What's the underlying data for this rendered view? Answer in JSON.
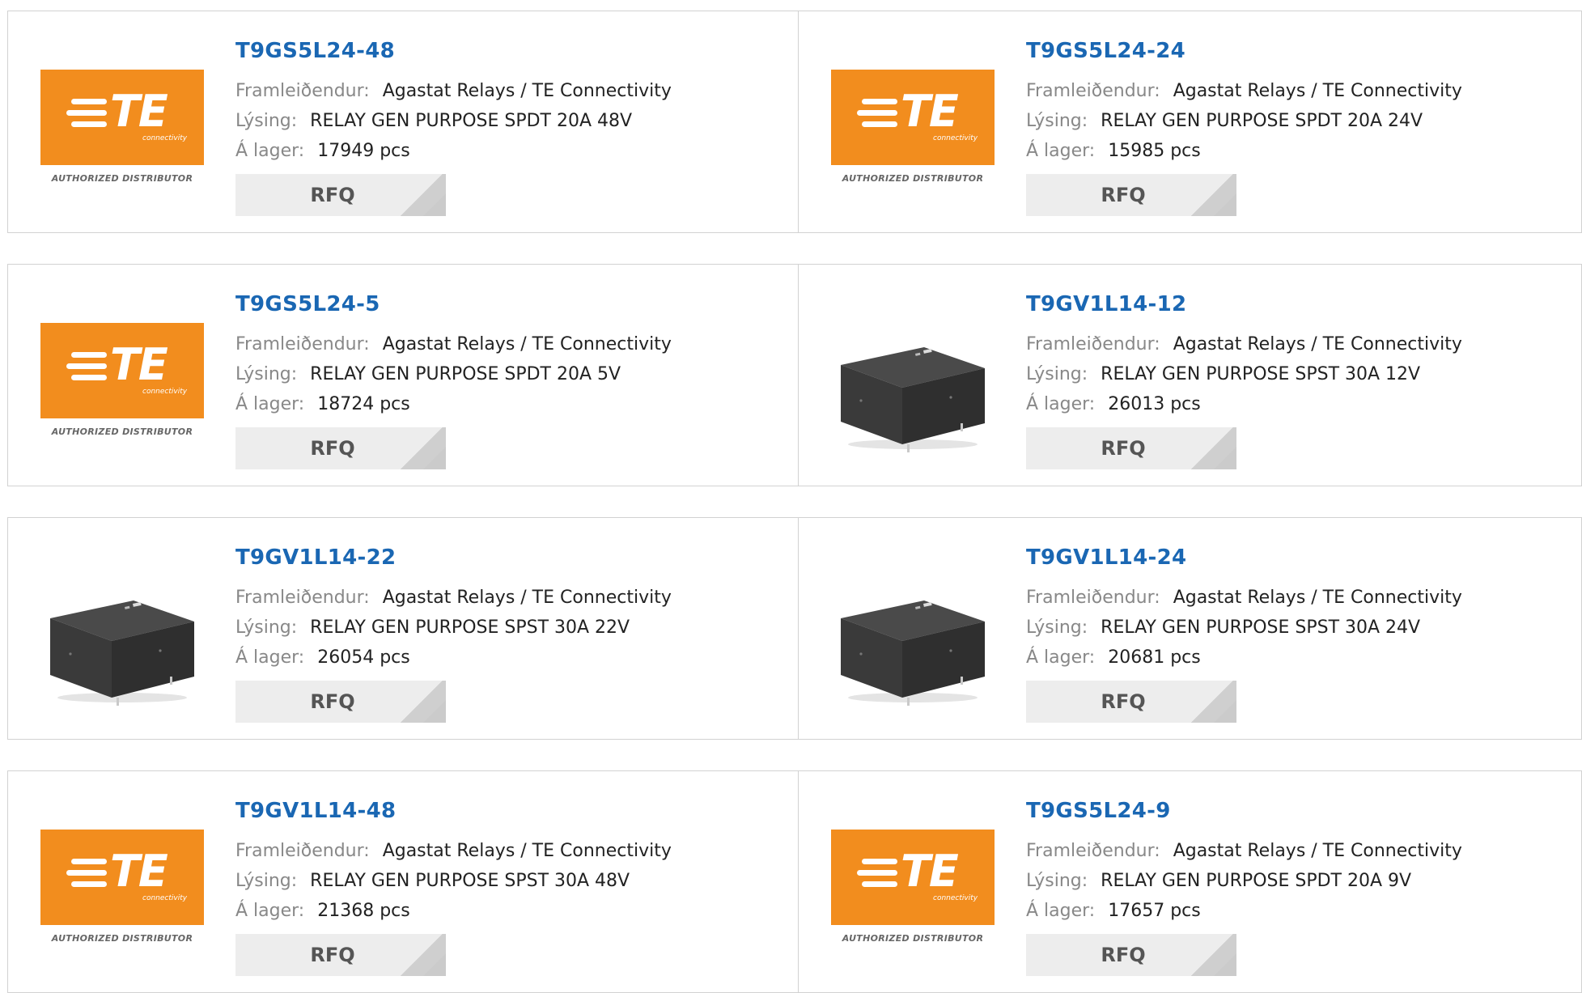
{
  "labels": {
    "manufacturer": "Framleiðendur:",
    "description": "Lýsing:",
    "stock": "Á lager:"
  },
  "brand": {
    "logo_text": "TE",
    "logo_sub": "connectivity",
    "authorized": "AUTHORIZED DISTRIBUTOR",
    "orange": "#f28d1e",
    "link_blue": "#1a67b3"
  },
  "products": [
    {
      "pn": "T9GS5L24-48",
      "mfr": "Agastat Relays / TE Connectivity",
      "desc": "RELAY GEN PURPOSE SPDT 20A 48V",
      "stock": "17949 pcs",
      "image": "te-logo",
      "rfq": "RFQ"
    },
    {
      "pn": "T9GS5L24-24",
      "mfr": "Agastat Relays / TE Connectivity",
      "desc": "RELAY GEN PURPOSE SPDT 20A 24V",
      "stock": "15985 pcs",
      "image": "te-logo",
      "rfq": "RFQ"
    },
    {
      "pn": "T9GS5L24-5",
      "mfr": "Agastat Relays / TE Connectivity",
      "desc": "RELAY GEN PURPOSE SPDT 20A 5V",
      "stock": "18724 pcs",
      "image": "te-logo",
      "rfq": "RFQ"
    },
    {
      "pn": "T9GV1L14-12",
      "mfr": "Agastat Relays / TE Connectivity",
      "desc": "RELAY GEN PURPOSE SPST 30A 12V",
      "stock": "26013 pcs",
      "image": "relay-photo",
      "rfq": "RFQ"
    },
    {
      "pn": "T9GV1L14-22",
      "mfr": "Agastat Relays / TE Connectivity",
      "desc": "RELAY GEN PURPOSE SPST 30A 22V",
      "stock": "26054 pcs",
      "image": "relay-photo",
      "rfq": "RFQ"
    },
    {
      "pn": "T9GV1L14-24",
      "mfr": "Agastat Relays / TE Connectivity",
      "desc": "RELAY GEN PURPOSE SPST 30A 24V",
      "stock": "20681 pcs",
      "image": "relay-photo",
      "rfq": "RFQ"
    },
    {
      "pn": "T9GV1L14-48",
      "mfr": "Agastat Relays / TE Connectivity",
      "desc": "RELAY GEN PURPOSE SPST 30A 48V",
      "stock": "21368 pcs",
      "image": "te-logo",
      "rfq": "RFQ"
    },
    {
      "pn": "T9GS5L24-9",
      "mfr": "Agastat Relays / TE Connectivity",
      "desc": "RELAY GEN PURPOSE SPDT 20A 9V",
      "stock": "17657 pcs",
      "image": "te-logo",
      "rfq": "RFQ"
    }
  ]
}
